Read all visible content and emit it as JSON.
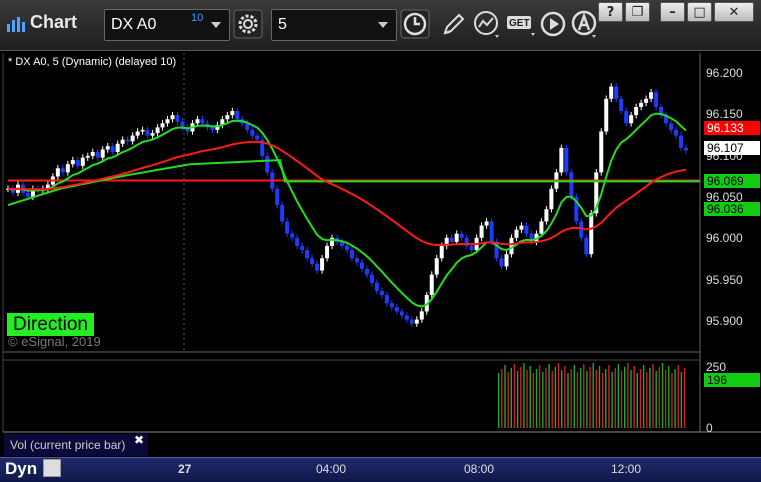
{
  "window": {
    "title": "Chart",
    "symbol": "DX A0",
    "symbol_superscript": "10",
    "interval": "5",
    "buttons": {
      "help": "?",
      "restore": "❐",
      "minimize": "–",
      "maximize": "□",
      "close": "✕"
    }
  },
  "chart": {
    "legend": "* DX A0, 5 (Dynamic) (delayed 10)",
    "direction_label": "Direction",
    "copyright": "© eSignal, 2019",
    "price_ticks": [
      "96.200",
      "96.150",
      "96.100",
      "96.050",
      "96.000",
      "95.950",
      "95.900"
    ],
    "price_labels": {
      "red": "96.133",
      "last": "96.107",
      "green1": "96.069",
      "green2": "96.036"
    },
    "colors": {
      "up_candle": "#ffffff",
      "down_candle": "#1e3cff",
      "red_line": "#ff1a1a",
      "green_line": "#22dd22",
      "label_red": "#ff0000",
      "label_green": "#11cc11"
    }
  },
  "volume": {
    "label": "Vol (current price bar)",
    "close": "✖",
    "ticks": [
      "250",
      "0"
    ],
    "value_label": "196"
  },
  "timeline": {
    "mode": "Dyn",
    "ticks": [
      "27",
      "04:00",
      "08:00",
      "12:00"
    ]
  },
  "chart_data": {
    "type": "candlestick",
    "ylim": [
      95.875,
      96.215
    ],
    "x": "bar index",
    "y_unit": "price",
    "closes": [
      96.06,
      96.055,
      96.065,
      96.055,
      96.05,
      96.06,
      96.058,
      96.06,
      96.065,
      96.075,
      96.085,
      96.08,
      96.09,
      96.095,
      96.088,
      96.098,
      96.1,
      96.105,
      96.098,
      96.108,
      96.112,
      96.105,
      96.115,
      96.12,
      96.118,
      96.125,
      96.13,
      96.132,
      96.125,
      96.128,
      96.135,
      96.14,
      96.145,
      96.15,
      96.142,
      96.135,
      96.13,
      96.14,
      96.145,
      96.14,
      96.135,
      96.132,
      96.138,
      96.145,
      96.15,
      96.155,
      96.145,
      96.14,
      96.132,
      96.125,
      96.12,
      96.1,
      96.08,
      96.06,
      96.04,
      96.02,
      96.005,
      96.0,
      95.99,
      95.985,
      95.975,
      95.968,
      95.96,
      95.975,
      95.99,
      96.0,
      95.995,
      95.99,
      95.985,
      95.975,
      95.97,
      95.962,
      95.955,
      95.945,
      95.935,
      95.93,
      95.92,
      95.915,
      95.91,
      95.905,
      95.9,
      95.895,
      95.9,
      95.91,
      95.93,
      95.955,
      95.975,
      95.99,
      96.0,
      95.995,
      96.005,
      96.0,
      95.99,
      95.985,
      96.0,
      96.015,
      96.02,
      95.995,
      95.975,
      95.965,
      95.98,
      96.0,
      96.01,
      96.015,
      96.005,
      95.995,
      96.005,
      96.02,
      96.035,
      96.06,
      96.08,
      96.11,
      96.08,
      96.05,
      96.02,
      96.0,
      95.98,
      96.03,
      96.08,
      96.13,
      96.17,
      96.185,
      96.17,
      96.155,
      96.14,
      96.15,
      96.16,
      96.165,
      96.17,
      96.178,
      96.16,
      96.15,
      96.14,
      96.132,
      96.125,
      96.11,
      96.107
    ],
    "red_line": [
      96.07,
      96.07,
      96.07,
      96.07,
      96.07,
      96.07,
      96.07,
      96.07,
      96.07,
      96.07,
      96.07,
      96.07,
      96.07,
      96.07,
      96.07,
      96.07,
      96.07,
      96.07,
      96.07,
      96.07,
      96.07,
      96.07,
      96.07,
      96.07,
      96.07,
      96.07,
      96.07,
      96.07,
      96.07,
      96.07,
      96.07,
      96.07,
      96.07,
      96.07,
      96.07,
      96.07,
      96.07,
      96.07,
      96.07,
      96.07,
      96.07,
      96.07,
      96.07,
      96.07,
      96.07,
      96.07,
      96.07,
      96.07,
      96.07,
      96.07,
      96.07,
      96.07,
      96.07,
      96.07,
      96.07,
      96.07,
      96.07,
      96.07,
      96.07,
      96.07,
      96.07,
      96.07,
      96.07,
      96.07,
      96.07,
      96.07,
      96.07,
      96.07,
      96.07,
      96.07,
      96.07,
      96.07,
      96.07,
      96.07,
      96.07,
      96.07,
      96.07,
      96.07,
      96.07,
      96.07,
      96.07,
      96.07,
      96.07,
      96.07,
      96.07,
      96.07,
      96.07,
      96.07,
      96.07,
      96.07,
      96.07,
      96.07,
      96.07,
      96.07,
      96.07,
      96.07,
      96.07,
      96.07,
      96.07,
      96.07,
      96.07,
      96.07,
      96.07,
      96.07,
      96.07,
      96.07,
      96.07,
      96.07,
      96.07,
      96.07,
      96.07,
      96.07,
      96.07,
      96.07,
      96.07,
      96.07,
      96.07,
      96.07,
      96.07,
      96.07,
      96.07,
      96.07,
      96.07,
      96.07,
      96.07,
      96.07,
      96.07,
      96.07,
      96.07,
      96.07,
      96.07,
      96.07,
      96.07,
      96.07,
      96.07,
      96.07,
      96.07,
      96.07,
      96.07,
      96.07
    ]
  }
}
